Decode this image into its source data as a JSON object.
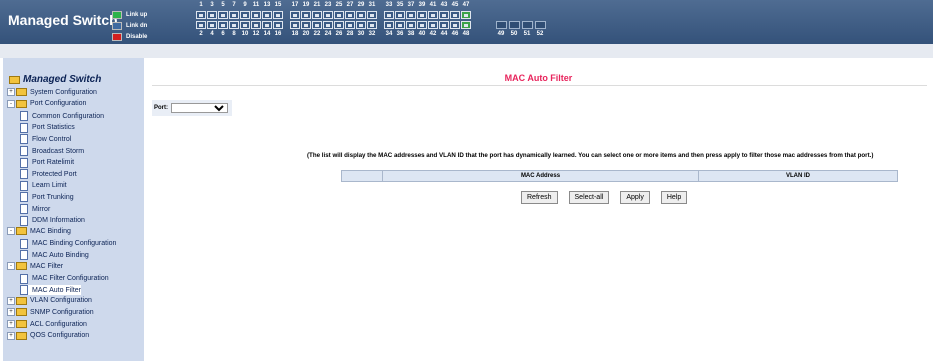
{
  "header": {
    "brand": "Managed Switch",
    "legend": [
      {
        "label": "Link up",
        "color": "#2db34a"
      },
      {
        "label": "Link dn",
        "color": "#3f6aa0"
      },
      {
        "label": "Disable",
        "color": "#d11f1f"
      }
    ],
    "top_port_numbers": [
      "1",
      "3",
      "5",
      "7",
      "9",
      "11",
      "13",
      "15",
      "17",
      "19",
      "21",
      "23",
      "25",
      "27",
      "29",
      "31",
      "33",
      "35",
      "37",
      "39",
      "41",
      "43",
      "45",
      "47"
    ],
    "bottom_port_numbers": [
      "2",
      "4",
      "6",
      "8",
      "10",
      "12",
      "14",
      "16",
      "18",
      "20",
      "22",
      "24",
      "26",
      "28",
      "30",
      "32",
      "34",
      "36",
      "38",
      "40",
      "42",
      "44",
      "46",
      "48"
    ],
    "sfp_numbers": [
      "49",
      "50",
      "51",
      "52"
    ],
    "link_up_ports": [
      "47",
      "48"
    ]
  },
  "sidebar": {
    "title": "Managed Switch",
    "items": [
      {
        "label": "System Configuration",
        "level": 1,
        "type": "folder",
        "expander": "+"
      },
      {
        "label": "Port Configuration",
        "level": 1,
        "type": "folder",
        "expander": "-"
      },
      {
        "label": "Common Configuration",
        "level": 2,
        "type": "page"
      },
      {
        "label": "Port Statistics",
        "level": 2,
        "type": "page"
      },
      {
        "label": "Flow Control",
        "level": 2,
        "type": "page"
      },
      {
        "label": "Broadcast Storm",
        "level": 2,
        "type": "page"
      },
      {
        "label": "Port Ratelimit",
        "level": 2,
        "type": "page"
      },
      {
        "label": "Protected Port",
        "level": 2,
        "type": "page"
      },
      {
        "label": "Learn Limit",
        "level": 2,
        "type": "page"
      },
      {
        "label": "Port Trunking",
        "level": 2,
        "type": "page"
      },
      {
        "label": "Mirror",
        "level": 2,
        "type": "page"
      },
      {
        "label": "DDM Information",
        "level": 2,
        "type": "page"
      },
      {
        "label": "MAC Binding",
        "level": 1,
        "type": "folder",
        "expander": "-"
      },
      {
        "label": "MAC Binding Configuration",
        "level": 2,
        "type": "page"
      },
      {
        "label": "MAC Auto Binding",
        "level": 2,
        "type": "page"
      },
      {
        "label": "MAC Filter",
        "level": 1,
        "type": "folder",
        "expander": "-"
      },
      {
        "label": "MAC Filter Configuration",
        "level": 2,
        "type": "page"
      },
      {
        "label": "MAC Auto Filter",
        "level": 2,
        "type": "page",
        "selected": true
      },
      {
        "label": "VLAN Configuration",
        "level": 1,
        "type": "folder",
        "expander": "+"
      },
      {
        "label": "SNMP Configuration",
        "level": 1,
        "type": "folder",
        "expander": "+"
      },
      {
        "label": "ACL Configuration",
        "level": 1,
        "type": "folder",
        "expander": "+"
      },
      {
        "label": "QOS Configuration",
        "level": 1,
        "type": "folder",
        "expander": "+"
      }
    ]
  },
  "main": {
    "title": "MAC Auto Filter",
    "port_label": "Port:",
    "port_value": "",
    "info_text": "(The list will display the MAC addresses and VLAN ID that the port has dynamically learned. You can select one or more items and then press apply to filter those mac addresses from that port.)",
    "table_headers": [
      "",
      "MAC Address",
      "VLAN ID"
    ],
    "buttons": {
      "refresh": "Refresh",
      "select_all": "Select-all",
      "apply": "Apply",
      "help": "Help"
    },
    "title_color": "#e8245c"
  }
}
